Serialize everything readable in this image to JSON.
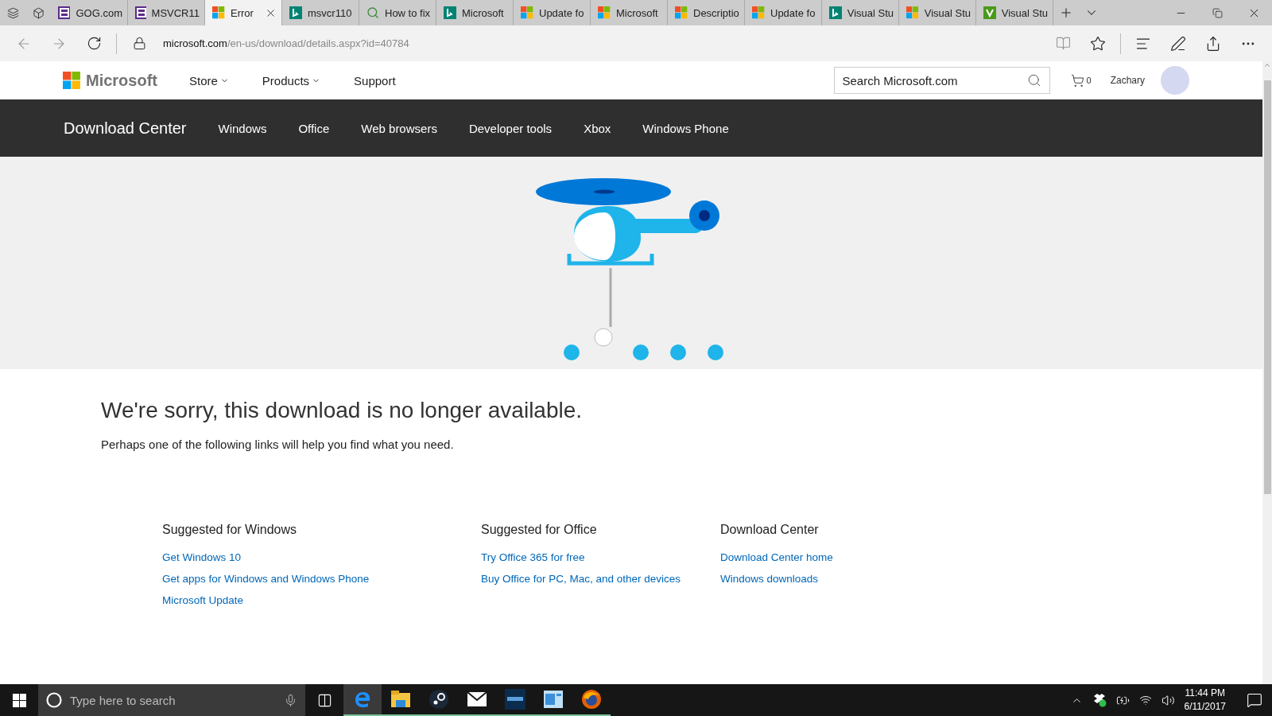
{
  "tabs": [
    {
      "label": "GOG.com",
      "kind": "gog",
      "selected": false
    },
    {
      "label": "MSVCR11",
      "kind": "gog",
      "selected": false
    },
    {
      "label": "Error",
      "kind": "ms",
      "selected": true
    },
    {
      "label": "msvcr110",
      "kind": "bing",
      "selected": false
    },
    {
      "label": "How to fix",
      "kind": "magnifier",
      "selected": false
    },
    {
      "label": "Microsoft",
      "kind": "bing",
      "selected": false
    },
    {
      "label": "Update fo",
      "kind": "ms",
      "selected": false
    },
    {
      "label": "Microsoft",
      "kind": "ms",
      "selected": false
    },
    {
      "label": "Descriptio",
      "kind": "ms",
      "selected": false
    },
    {
      "label": "Update fo",
      "kind": "ms",
      "selected": false
    },
    {
      "label": "Visual Stu",
      "kind": "bing",
      "selected": false
    },
    {
      "label": "Visual Stu",
      "kind": "ms",
      "selected": false
    },
    {
      "label": "Visual Stu",
      "kind": "vs",
      "selected": false
    }
  ],
  "address": {
    "domain": "microsoft.com",
    "path": "/en-us/download/details.aspx?id=40784"
  },
  "site_header": {
    "logo": "Microsoft",
    "nav": [
      {
        "label": "Store",
        "dropdown": true
      },
      {
        "label": "Products",
        "dropdown": true
      },
      {
        "label": "Support",
        "dropdown": false
      }
    ],
    "search_placeholder": "Search Microsoft.com",
    "cart_count": "0",
    "user": "Zachary"
  },
  "download_nav": {
    "title": "Download Center",
    "items": [
      "Windows",
      "Office",
      "Web browsers",
      "Developer tools",
      "Xbox",
      "Windows Phone"
    ]
  },
  "error": {
    "heading": "We're sorry, this download is no longer available.",
    "message": "Perhaps one of the following links will help you find what you need."
  },
  "suggestions": [
    {
      "title": "Suggested for Windows",
      "links": [
        "Get Windows 10",
        "Get apps for Windows and Windows Phone",
        "Microsoft Update"
      ]
    },
    {
      "title": "Suggested for Office",
      "links": [
        "Try Office 365 for free",
        "Buy Office for PC, Mac, and other devices"
      ]
    },
    {
      "title": "Download Center",
      "links": [
        "Download Center home",
        "Windows downloads"
      ]
    }
  ],
  "taskbar": {
    "search_placeholder": "Type here to search",
    "apps": [
      {
        "kind": "edge",
        "active": true
      },
      {
        "kind": "explorer",
        "active": false
      },
      {
        "kind": "steam",
        "active": false
      },
      {
        "kind": "mail",
        "active": false
      },
      {
        "kind": "blizzard",
        "active": false
      },
      {
        "kind": "control",
        "active": false
      },
      {
        "kind": "firefox",
        "active": false
      }
    ],
    "time": "11:44 PM",
    "date": "6/11/2017"
  }
}
